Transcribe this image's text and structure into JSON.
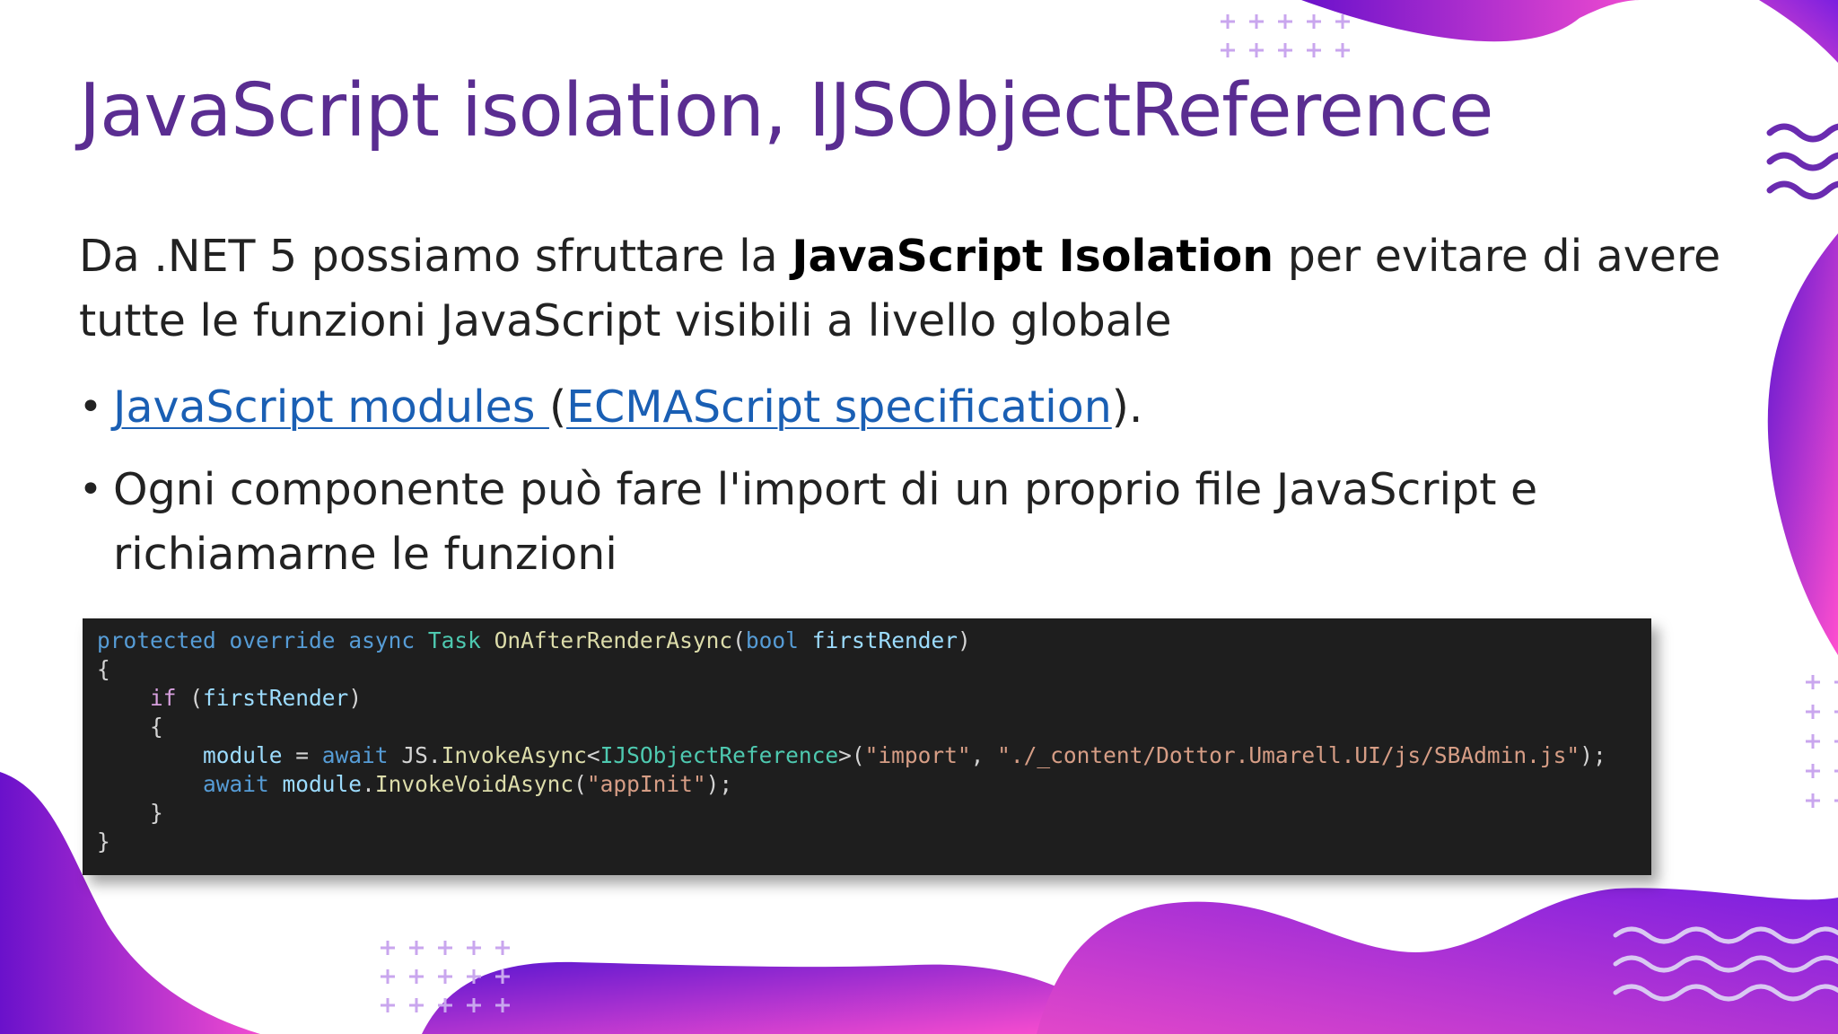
{
  "slide": {
    "title": "JavaScript isolation, IJSObjectReference",
    "intro": {
      "part1": "Da .NET 5 possiamo sfruttare la ",
      "bold": "JavaScript Isolation",
      "part2": " per evitare di avere tutte le funzioni JavaScript visibili a livello globale"
    },
    "bullets": {
      "first": {
        "link1": "JavaScript modules ",
        "open": "(",
        "link2": "ECMAScript specification",
        "close": ")."
      },
      "second": "Ogni componente può fare l'import di un proprio file JavaScript e richiamarne le funzioni"
    },
    "bullet_symbol": "•"
  },
  "code": {
    "lines": [
      [
        [
          "kw",
          "protected"
        ],
        [
          "pl",
          " "
        ],
        [
          "kw",
          "override"
        ],
        [
          "pl",
          " "
        ],
        [
          "kw",
          "async"
        ],
        [
          "pl",
          " "
        ],
        [
          "ty",
          "Task"
        ],
        [
          "pl",
          " "
        ],
        [
          "fn",
          "OnAfterRenderAsync"
        ],
        [
          "pl",
          "("
        ],
        [
          "kw",
          "bool"
        ],
        [
          "pl",
          " "
        ],
        [
          "id",
          "firstRender"
        ],
        [
          "pl",
          ")"
        ]
      ],
      [
        [
          "pl",
          "{"
        ]
      ],
      [
        [
          "pl",
          "    "
        ],
        [
          "ctl",
          "if"
        ],
        [
          "pl",
          " ("
        ],
        [
          "id",
          "firstRender"
        ],
        [
          "pl",
          ")"
        ]
      ],
      [
        [
          "pl",
          "    {"
        ]
      ],
      [
        [
          "pl",
          "        "
        ],
        [
          "id",
          "module"
        ],
        [
          "pl",
          " = "
        ],
        [
          "kw",
          "await"
        ],
        [
          "pl",
          " JS."
        ],
        [
          "fn",
          "InvokeAsync"
        ],
        [
          "pl",
          "<"
        ],
        [
          "ty",
          "IJSObjectReference"
        ],
        [
          "pl",
          ">("
        ],
        [
          "st",
          "\"import\""
        ],
        [
          "pl",
          ", "
        ],
        [
          "st",
          "\"./_content/Dottor.Umarell.UI/js/SBAdmin.js\""
        ],
        [
          "pl",
          ");"
        ]
      ],
      [
        [
          "pl",
          "        "
        ],
        [
          "kw",
          "await"
        ],
        [
          "pl",
          " "
        ],
        [
          "id",
          "module"
        ],
        [
          "pl",
          "."
        ],
        [
          "fn",
          "InvokeVoidAsync"
        ],
        [
          "pl",
          "("
        ],
        [
          "st",
          "\"appInit\""
        ],
        [
          "pl",
          ");"
        ]
      ],
      [
        [
          "pl",
          "    }"
        ]
      ],
      [
        [
          "pl",
          "}"
        ]
      ]
    ]
  },
  "colors": {
    "title": "#5a2d91",
    "link": "#1a5fb4",
    "purple": "#7a1fd6",
    "magenta": "#e040c8",
    "code_bg": "#1e1e1e"
  },
  "decor_icons": [
    "plus-grid-icon",
    "wave-lines-icon",
    "gradient-blob"
  ]
}
